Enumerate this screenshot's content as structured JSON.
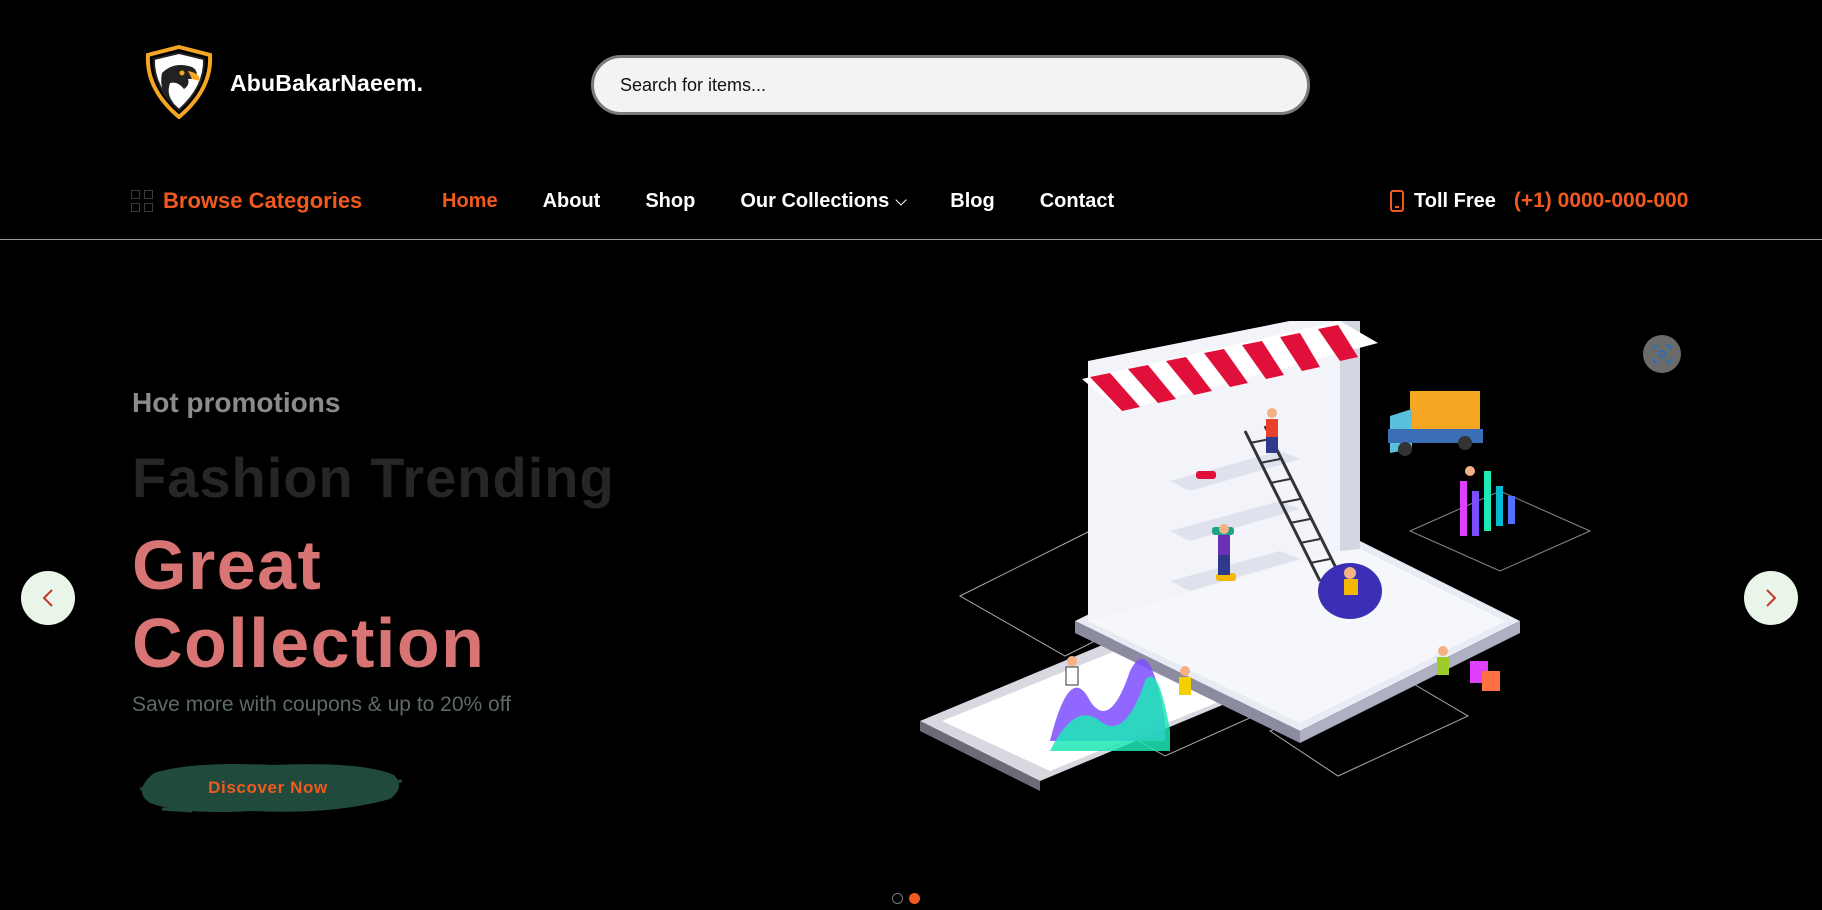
{
  "brand": {
    "name": "AbuBakarNaeem.",
    "logo_icon": "eagle-shield-logo"
  },
  "search": {
    "placeholder": "Search for items..."
  },
  "browse": {
    "label": "Browse Categories",
    "icon": "grid-icon"
  },
  "nav": {
    "home": "Home",
    "about": "About",
    "shop": "Shop",
    "collections": "Our Collections",
    "blog": "Blog",
    "contact": "Contact"
  },
  "toll": {
    "label": "Toll Free",
    "number": "(+1) 0000-000-000"
  },
  "hero": {
    "promo": "Hot promotions",
    "trend": "Fashion Trending",
    "headline": "Great Collection",
    "subtext": "Save more with coupons & up to 20% off",
    "cta": "Discover Now"
  },
  "colors": {
    "accent": "#f05a1e",
    "headline": "#d97474",
    "cta_bg": "#1f4a3c",
    "background": "#000000"
  },
  "slider": {
    "active_index": 2,
    "total": 2
  }
}
